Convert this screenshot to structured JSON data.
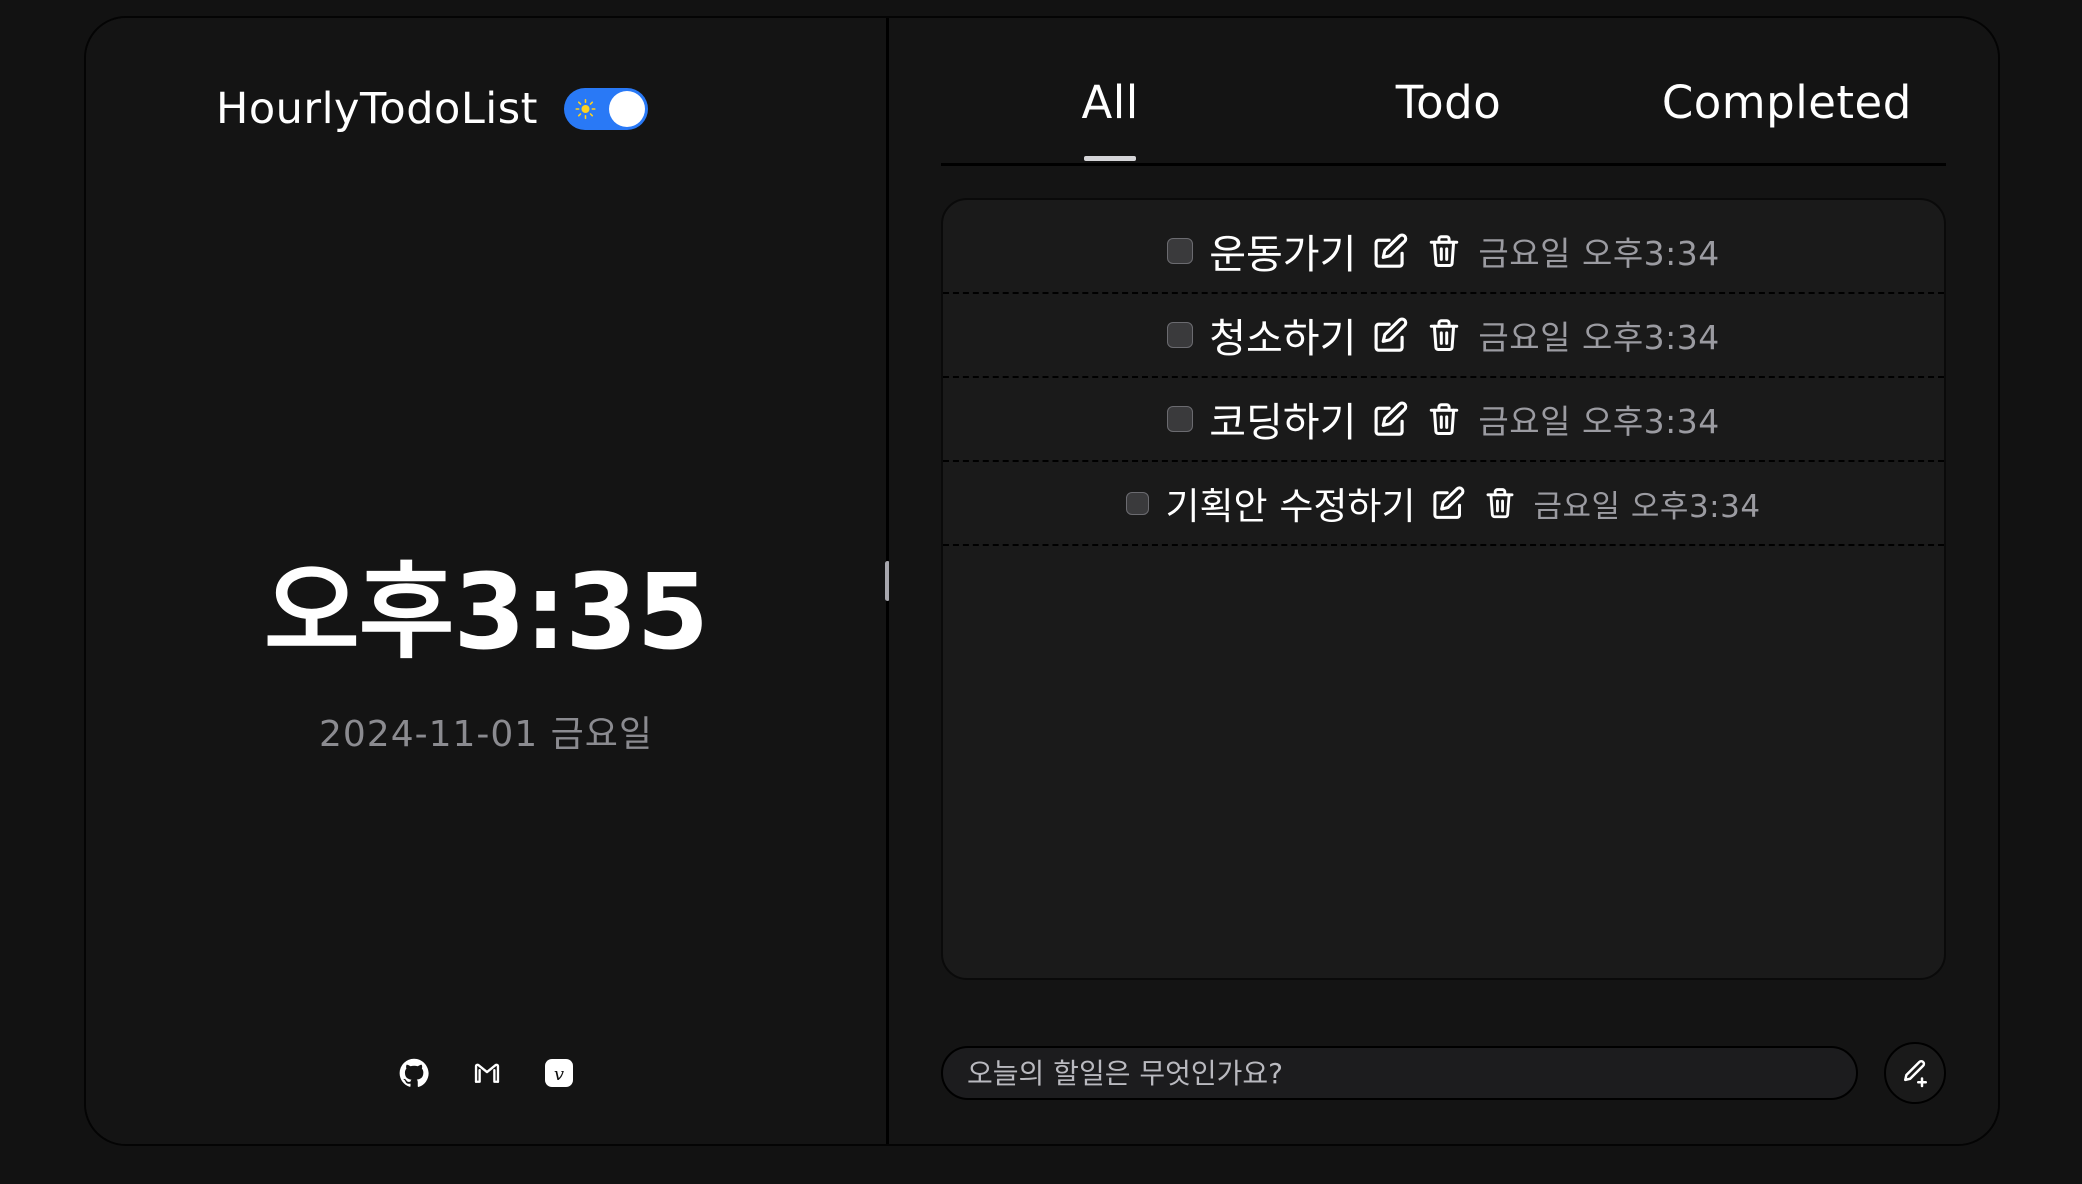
{
  "app": {
    "title": "HourlyTodoList",
    "theme_toggle": {
      "state": "light",
      "icon": "sun-icon"
    }
  },
  "clock": {
    "time": "오후3:35",
    "date": "2024-11-01 금요일"
  },
  "footer_links": [
    {
      "name": "github-icon",
      "label": "GitHub"
    },
    {
      "name": "gmail-icon",
      "label": "Gmail"
    },
    {
      "name": "velog-icon",
      "label": "velog"
    }
  ],
  "tabs": [
    {
      "label": "All",
      "active": true
    },
    {
      "label": "Todo",
      "active": false
    },
    {
      "label": "Completed",
      "active": false
    }
  ],
  "todos": [
    {
      "text": "운동가기",
      "time": "금요일 오후3:34",
      "checked": false
    },
    {
      "text": "청소하기",
      "time": "금요일 오후3:34",
      "checked": false
    },
    {
      "text": "코딩하기",
      "time": "금요일 오후3:34",
      "checked": false
    },
    {
      "text": "기획안 수정하기",
      "time": "금요일 오후3:34",
      "checked": false
    }
  ],
  "input": {
    "value": "",
    "placeholder": "오늘의 할일은 무엇인가요?"
  },
  "add_button": {
    "icon": "pencil-plus-icon"
  },
  "colors": {
    "background": "#121212",
    "card": "#151515",
    "accent_toggle": "#2979f6",
    "sun": "#ffd21f",
    "text_primary": "#ffffff",
    "text_muted": "#9b9ba1"
  }
}
